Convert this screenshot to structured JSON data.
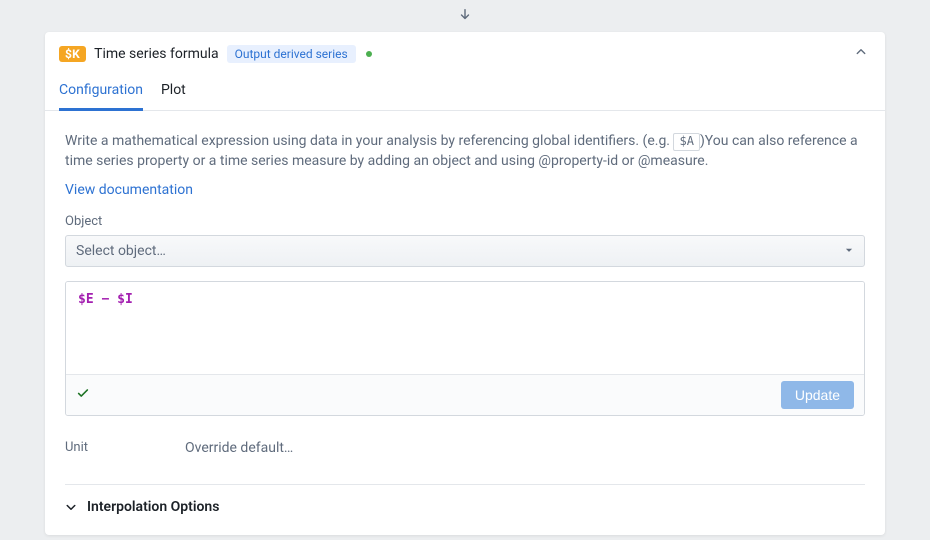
{
  "header": {
    "badge": "$K",
    "title": "Time series formula",
    "pill": "Output derived series"
  },
  "tabs": [
    {
      "id": "configuration",
      "label": "Configuration",
      "active": true
    },
    {
      "id": "plot",
      "label": "Plot",
      "active": false
    }
  ],
  "description": {
    "part1": "Write a mathematical expression using data in your analysis by referencing global identifiers. (e.g. ",
    "code": "$A",
    "part2": ")You can also reference a time series property or a time series measure by adding an object and using @property-id or @measure."
  },
  "docLink": "View documentation",
  "object": {
    "label": "Object",
    "placeholder": "Select object…"
  },
  "formula": {
    "var1": "$E",
    "op": "−",
    "var2": "$I"
  },
  "updateButton": "Update",
  "unit": {
    "label": "Unit",
    "value": "Override default…"
  },
  "interpolation": {
    "title": "Interpolation Options"
  }
}
